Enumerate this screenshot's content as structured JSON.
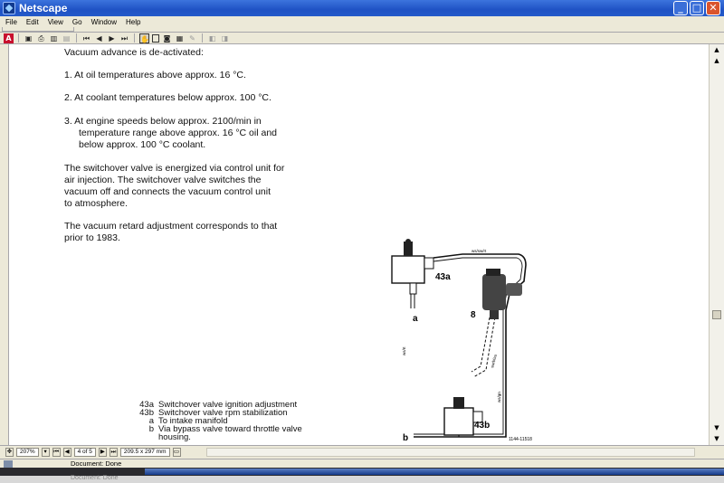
{
  "window": {
    "title": "Netscape"
  },
  "menu": [
    "File",
    "Edit",
    "View",
    "Go",
    "Window",
    "Help"
  ],
  "document": {
    "intro": "Vacuum advance is de-activated:",
    "items": [
      {
        "num": "1.",
        "lines": [
          "At oil temperatures above approx. 16 °C."
        ]
      },
      {
        "num": "2.",
        "lines": [
          "At coolant temperatures below approx. 100 °C."
        ]
      },
      {
        "num": "3.",
        "lines": [
          "At engine speeds below approx. 2100/min in",
          "temperature range above approx. 16 °C oil and",
          "below approx. 100 °C coolant."
        ]
      }
    ],
    "para1": [
      "The switchover valve is energized via control unit for",
      "air injection. The switchover valve switches the",
      "vacuum off and connects the vacuum control unit",
      "to atmosphere."
    ],
    "para2": [
      "The vacuum retard adjustment corresponds to that",
      "prior to 1983."
    ],
    "legend": [
      {
        "code": "43a",
        "text": "Switchover valve ignition adjustment"
      },
      {
        "code": "43b",
        "text": "Switchover valve rpm stabilization"
      },
      {
        "code": "a",
        "text": "To intake manifold"
      },
      {
        "code": "b",
        "text": "Via bypass valve toward throttle valve"
      },
      {
        "code": "",
        "text": "housing."
      }
    ]
  },
  "diagram": {
    "labels": {
      "valve_a": "43a",
      "valve_b": "43b",
      "part8": "8",
      "port_a": "a",
      "port_b": "b",
      "ref": "1144-11518"
    },
    "hose_colors": {
      "top": "ws/sw/rt",
      "left": "ws/rt",
      "mid": "sw/blau",
      "lower": "ws/gn"
    }
  },
  "viewer": {
    "zoom": "207%",
    "page": "4 of 5",
    "page_size": "209.5 x 297 mm"
  },
  "status": {
    "text": "Document: Done",
    "ghost_text": "Document: Done"
  }
}
